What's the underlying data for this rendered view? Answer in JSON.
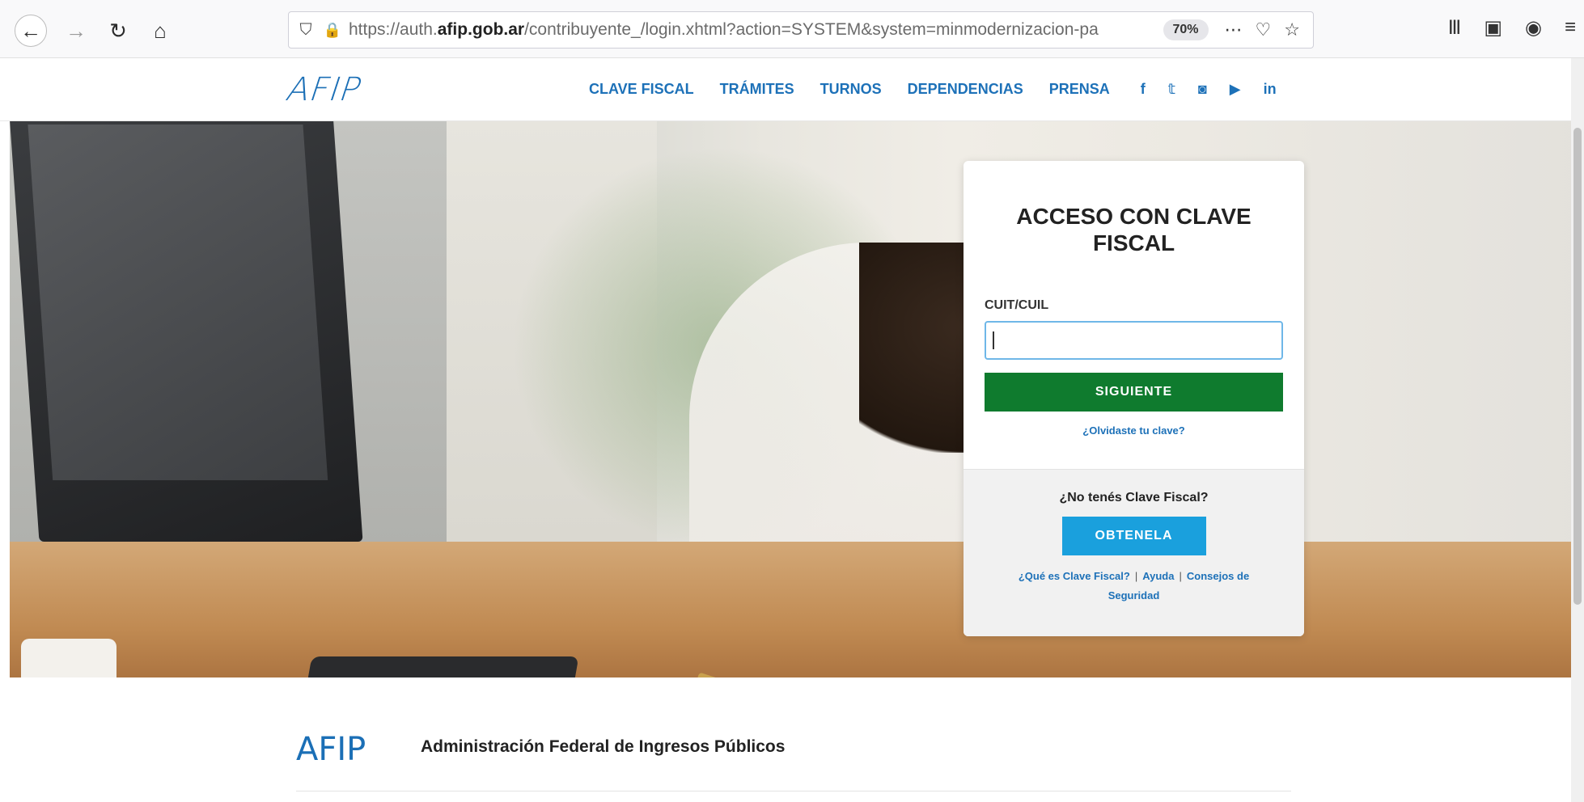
{
  "browser": {
    "url_prefix": "https://auth.",
    "url_domain": "afip.gob.ar",
    "url_rest": "/contribuyente_/login.xhtml?action=SYSTEM&system=minmodernizacion-pa",
    "zoom": "70%",
    "icons": [
      "back-icon",
      "forward-icon",
      "reload-icon",
      "home-icon",
      "shield-icon",
      "lock-icon",
      "more-icon",
      "pocket-icon",
      "bookmark-star-icon",
      "library-icon",
      "sidebar-icon",
      "account-icon",
      "menu-icon"
    ]
  },
  "header": {
    "logo": "AFIP",
    "nav": [
      "CLAVE FISCAL",
      "TRÁMITES",
      "TURNOS",
      "DEPENDENCIAS",
      "PRENSA"
    ],
    "social": [
      "f",
      "𝕥",
      "◙",
      "▶",
      "in"
    ]
  },
  "login": {
    "title": "ACCESO CON CLAVE FISCAL",
    "cuit_label": "CUIT/CUIL",
    "cuit_value": "",
    "next_button": "SIGUIENTE",
    "forgot_link": "¿Olvidaste tu clave?",
    "no_clave": "¿No tenés Clave Fiscal?",
    "obtain_button": "OBTENELA",
    "links": [
      "¿Qué es Clave Fiscal?",
      "Ayuda",
      "Consejos de Seguridad"
    ],
    "separator": "|"
  },
  "footer": {
    "logo": "AFIP",
    "org_name": "Administración Federal de Ingresos Públicos"
  },
  "colors": {
    "brand_blue": "#1d71b8",
    "green_button": "#0f7b2e",
    "cyan_button": "#1aa0dd"
  }
}
